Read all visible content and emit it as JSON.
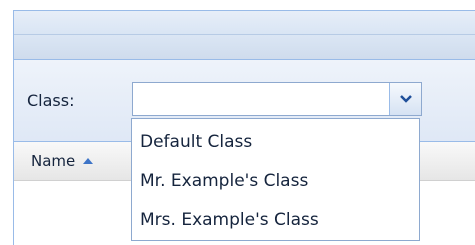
{
  "filter": {
    "label": "Class:",
    "combo_value": "",
    "trigger_icon": "chevron-down-icon"
  },
  "grid": {
    "columns": [
      {
        "label": "Name",
        "sort": "ascending",
        "sort_icon": "sort-ascending-icon"
      }
    ]
  },
  "dropdown": {
    "options": [
      {
        "label": "Default Class"
      },
      {
        "label": "Mr. Example's Class"
      },
      {
        "label": "Mrs. Example's Class"
      }
    ]
  },
  "colors": {
    "border": "#99bbe8",
    "accent": "#3d74c7",
    "text": "#15243d"
  }
}
